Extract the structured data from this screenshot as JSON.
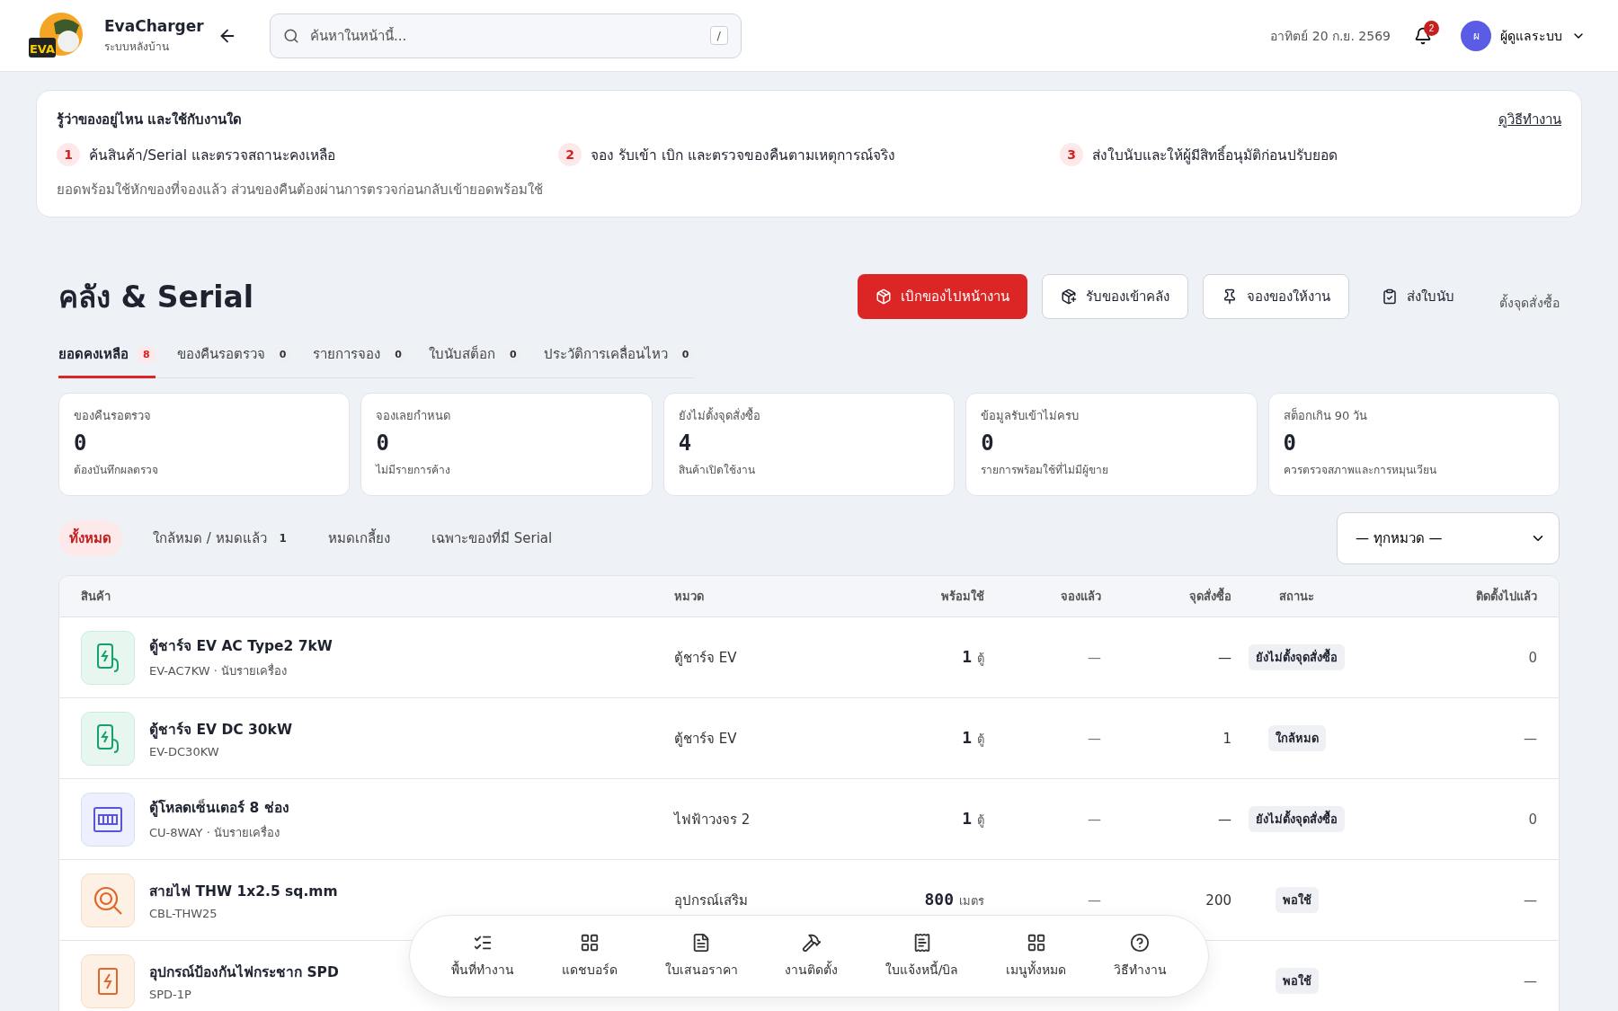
{
  "header": {
    "brand": "EvaCharger",
    "subtitle": "ระบบหลังบ้าน",
    "logo_text": "EVA",
    "search_placeholder": "ค้นหาในหน้านี้...",
    "shortcut": "/",
    "date": "อาทิตย์ 20 ก.ย. 2569",
    "notifications": "2",
    "user_initial": "ผ",
    "user_name": "ผู้ดูแลระบบ"
  },
  "guide": {
    "title": "รู้ว่าของอยู่ไหน และใช้กับงานใด",
    "link": "ดูวิธีทำงาน",
    "steps": [
      {
        "number": "1",
        "text": "ค้นสินค้า/Serial และตรวจสถานะคงเหลือ"
      },
      {
        "number": "2",
        "text": "จอง รับเข้า เบิก และตรวจของคืนตามเหตุการณ์จริง"
      },
      {
        "number": "3",
        "text": "ส่งใบนับและให้ผู้มีสิทธิ์อนุมัติก่อนปรับยอด"
      }
    ],
    "note": "ยอดพร้อมใช้หักของที่จองแล้ว ส่วนของคืนต้องผ่านการตรวจก่อนกลับเข้ายอดพร้อมใช้"
  },
  "page_title": "คลัง & Serial",
  "actions": [
    {
      "label": "เบิกของไปหน้างาน",
      "kind": "primary"
    },
    {
      "label": "รับของเข้าคลัง",
      "kind": "secondary"
    },
    {
      "label": "จองของให้งาน",
      "kind": "secondary"
    },
    {
      "label": "ส่งใบนับ",
      "kind": "plain"
    },
    {
      "label": "ตั้งจุดสั่งซื้อ",
      "kind": "link"
    }
  ],
  "tabs": [
    {
      "label": "ยอดคงเหลือ",
      "count": "8",
      "selected": true
    },
    {
      "label": "ของคืนรอตรวจ",
      "count": "0",
      "selected": false
    },
    {
      "label": "รายการจอง",
      "count": "0",
      "selected": false
    },
    {
      "label": "ใบนับสต็อก",
      "count": "0",
      "selected": false
    },
    {
      "label": "ประวัติการเคลื่อนไหว",
      "count": "0",
      "selected": false
    }
  ],
  "stats": [
    {
      "label": "ของคืนรอตรวจ",
      "value": "0",
      "note": "ต้องบันทึกผลตรวจ"
    },
    {
      "label": "จองเลยกำหนด",
      "value": "0",
      "note": "ไม่มีรายการค้าง"
    },
    {
      "label": "ยังไม่ตั้งจุดสั่งซื้อ",
      "value": "4",
      "note": "สินค้าเปิดใช้งาน"
    },
    {
      "label": "ข้อมูลรับเข้าไม่ครบ",
      "value": "0",
      "note": "รายการพร้อมใช้ที่ไม่มีผู้ขาย"
    },
    {
      "label": "สต็อกเกิน 90 วัน",
      "value": "0",
      "note": "ควรตรวจสภาพและการหมุนเวียน"
    }
  ],
  "filters": [
    {
      "label": "ทั้งหมด",
      "selected": true
    },
    {
      "label": "ใกล้หมด / หมดแล้ว",
      "count": "1",
      "selected": false
    },
    {
      "label": "หมดเกลี้ยง",
      "selected": false
    },
    {
      "label": "เฉพาะของที่มี Serial",
      "selected": false
    }
  ],
  "category_select": "— ทุกหมวด —",
  "table": {
    "columns": [
      "สินค้า",
      "หมวด",
      "พร้อมใช้",
      "จองแล้ว",
      "จุดสั่งซื้อ",
      "สถานะ",
      "ติดตั้งไปแล้ว"
    ],
    "rows": [
      {
        "kind": "charger",
        "name": "ตู้ชาร์จ EV AC Type2 7kW",
        "sku": "EV-AC7KW · นับรายเครื่อง",
        "category": "ตู้ชาร์จ EV",
        "ready": "1",
        "unit": "ตู้",
        "reserved": "—",
        "reorder": "—",
        "status": "ยังไม่ตั้งจุดสั่งซื้อ",
        "installed": "0"
      },
      {
        "kind": "charger",
        "name": "ตู้ชาร์จ EV DC 30kW",
        "sku": "EV-DC30KW",
        "category": "ตู้ชาร์จ EV",
        "ready": "1",
        "unit": "ตู้",
        "reserved": "—",
        "reorder": "1",
        "status": "ใกล้หมด",
        "installed": "—"
      },
      {
        "kind": "panel",
        "name": "ตู้โหลดเซ็นเตอร์ 8 ช่อง",
        "sku": "CU-8WAY · นับรายเครื่อง",
        "category": "ไฟฟ้าวงจร 2",
        "ready": "1",
        "unit": "ตู้",
        "reserved": "—",
        "reorder": "—",
        "status": "ยังไม่ตั้งจุดสั่งซื้อ",
        "installed": "0"
      },
      {
        "kind": "cable",
        "name": "สายไฟ THW 1x2.5 sq.mm",
        "sku": "CBL-THW25",
        "category": "อุปกรณ์เสริม",
        "ready": "800",
        "unit": "เมตร",
        "reserved": "—",
        "reorder": "200",
        "status": "พอใช้",
        "installed": "—"
      },
      {
        "kind": "surge",
        "name": "อุปกรณ์ป้องกันไฟกระชาก SPD",
        "sku": "SPD-1P",
        "status": "พอใช้",
        "installed": "—"
      }
    ]
  },
  "bottom_nav": [
    {
      "label": "พื้นที่ทำงาน"
    },
    {
      "label": "แดชบอร์ด"
    },
    {
      "label": "ใบเสนอราคา"
    },
    {
      "label": "งานติดตั้ง"
    },
    {
      "label": "ใบแจ้งหนี้/บิล"
    },
    {
      "label": "เมนูทั้งหมด"
    },
    {
      "label": "วิธีทำงาน"
    }
  ]
}
